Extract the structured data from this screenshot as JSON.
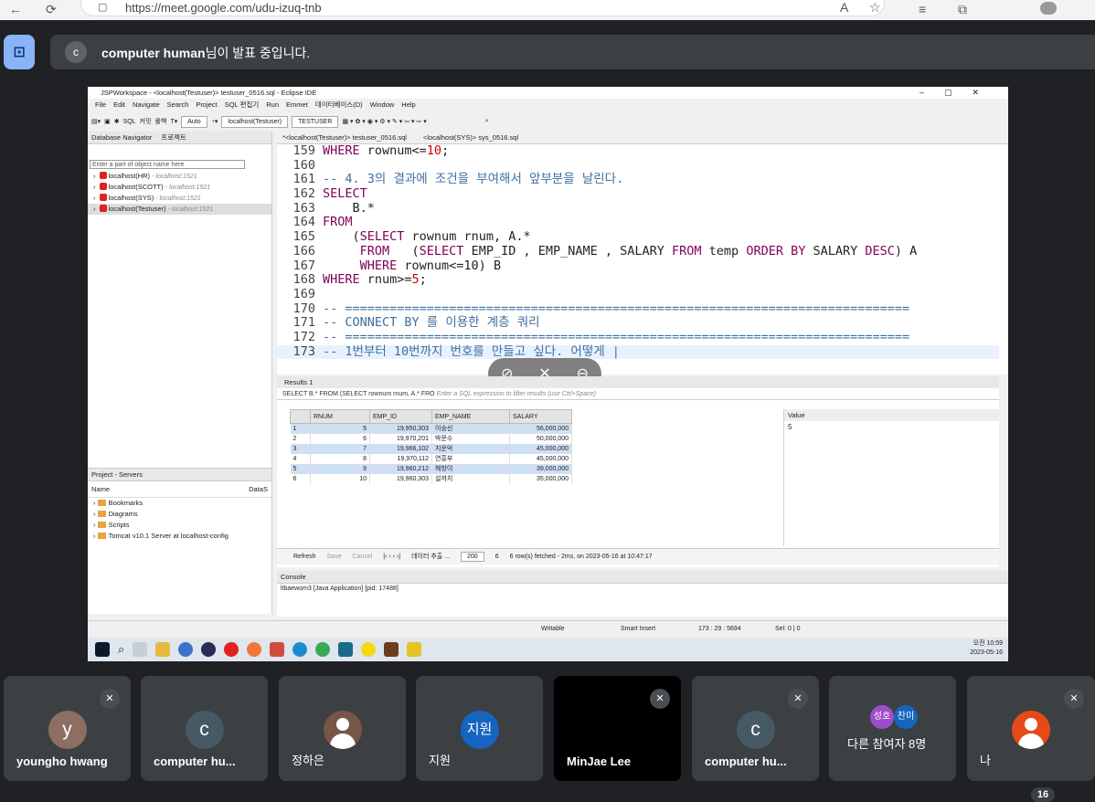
{
  "browser": {
    "url": "https://meet.google.com/udu-izuq-tnb"
  },
  "meet": {
    "presenter_initial": "c",
    "presenter_name": "computer human",
    "presenting_suffix": "님이 발표 중입니다.",
    "participant_count": "16",
    "tiles": [
      {
        "name": "youngho hwang",
        "initial": "y",
        "color": "#8d6e63"
      },
      {
        "name": "computer hu...",
        "initial": "c",
        "color": "#455a64"
      },
      {
        "name": "정하은",
        "initial": "",
        "color": "#795548"
      },
      {
        "name": "지원",
        "initial": "지원",
        "color": "#1565c0"
      },
      {
        "name": "MinJae Lee",
        "initial": "",
        "color": "#000000"
      },
      {
        "name": "computer hu...",
        "initial": "c",
        "color": "#455a64"
      },
      {
        "name": "다른 참여자 8명",
        "initial": "",
        "color": "#3c4043"
      },
      {
        "name": "나",
        "initial": "",
        "color": "#e64a19"
      }
    ],
    "others_avatars": [
      "성호",
      "찬미"
    ]
  },
  "eclipse": {
    "title": "JSPWorkspace - <localhost(Testuser)> testuser_0516.sql - Eclipse IDE",
    "menu": [
      "File",
      "Edit",
      "Navigate",
      "Search",
      "Project",
      "SQL 편집기",
      "Run",
      "Emmet",
      "데이터베이스(D)",
      "Window",
      "Help"
    ],
    "toolbar": {
      "sql": "SQL",
      "commit": "커밋",
      "rollback": "롤백",
      "auto": "Auto",
      "connection": "localhost(Testuser)",
      "schema": "TESTUSER"
    },
    "nav_tabs": [
      "Database Navigator",
      "프로젝트"
    ],
    "nav_filter_placeholder": "Enter a part of object name here",
    "connections": [
      {
        "name": "localhost(HR)",
        "host": "- localhost:1521"
      },
      {
        "name": "localhost(SCOTT)",
        "host": "- localhost:1521"
      },
      {
        "name": "localhost(SYS)",
        "host": "- localhost:1521"
      },
      {
        "name": "localhost(Testuser)",
        "host": "- localhost:1521"
      }
    ],
    "servers_tab": "Project - Servers",
    "servers_cols": [
      "Name",
      "DataS"
    ],
    "servers_items": [
      "Bookmarks",
      "Diagrams",
      "Scripts",
      "Tomcat v10.1 Server at localhost-config"
    ],
    "editor_tabs": [
      "*<localhost(Testuser)> testuser_0516.sql",
      "<localhost(SYS)> sys_0516.sql"
    ],
    "code": [
      {
        "n": "159",
        "t": "WHERE rownum<=10;"
      },
      {
        "n": "160",
        "t": ""
      },
      {
        "n": "161",
        "t": "-- 4. 3의 결과에 조건을 부여해서 앞부분을 날린다."
      },
      {
        "n": "162",
        "t": "SELECT"
      },
      {
        "n": "163",
        "t": "    B.*"
      },
      {
        "n": "164",
        "t": "FROM"
      },
      {
        "n": "165",
        "t": "    (SELECT rownum rnum, A.*"
      },
      {
        "n": "166",
        "t": "     FROM   (SELECT EMP_ID , EMP_NAME , SALARY FROM temp ORDER BY SALARY DESC) A"
      },
      {
        "n": "167",
        "t": "     WHERE rownum<=10) B"
      },
      {
        "n": "168",
        "t": "WHERE rnum>=5;"
      },
      {
        "n": "169",
        "t": ""
      },
      {
        "n": "170",
        "t": "-- ============================================================================"
      },
      {
        "n": "171",
        "t": "-- CONNECT BY 를 이용한 계층 쿼리"
      },
      {
        "n": "172",
        "t": "-- ============================================================================"
      },
      {
        "n": "173",
        "t": "-- 1번부터 10번까지 번호를 만들고 싶다. 어떻게 |"
      }
    ],
    "results_tab": "Results 1",
    "results_filter_sql": "SELECT B.* FROM (SELECT rownum rnum, A.* FRO",
    "results_filter_placeholder": "Enter a SQL expression to filter results (use Ctrl+Space)",
    "columns": [
      "RNUM",
      "EMP_ID",
      "EMP_NAME",
      "SALARY"
    ],
    "rows": [
      [
        "1",
        "5",
        "19,950,303",
        "이승신",
        "56,000,000"
      ],
      [
        "2",
        "6",
        "19,970,201",
        "박문수",
        "50,000,000"
      ],
      [
        "3",
        "7",
        "19,966,102",
        "지운억",
        "45,000,000"
      ],
      [
        "4",
        "8",
        "19,970,112",
        "연흥부",
        "45,000,000"
      ],
      [
        "5",
        "9",
        "19,960,212",
        "해방이",
        "39,000,000"
      ],
      [
        "6",
        "10",
        "19,960,303",
        "설까치",
        "35,000,000"
      ]
    ],
    "value_panel_title": "Value",
    "value_panel_value": "5",
    "refresh": "Refresh",
    "save": "Save",
    "cancel": "Cancel",
    "export": "데이터 추출 ...",
    "fetch_size": "200",
    "row_count": "6",
    "fetch_status": "6 row(s) fetched - 2ms, on 2023-05-16 at 10:47:17",
    "console_tab": "Console",
    "console_text": "ltbaewom3 [Java Application]  [pid: 17488]",
    "status": {
      "mode": "Writable",
      "insert": "Smart Insert",
      "pos": "173 : 29 : 5694",
      "sel": "Sel: 0 | 0"
    },
    "clock_time": "오전 10:59",
    "clock_date": "2023-05-16"
  }
}
